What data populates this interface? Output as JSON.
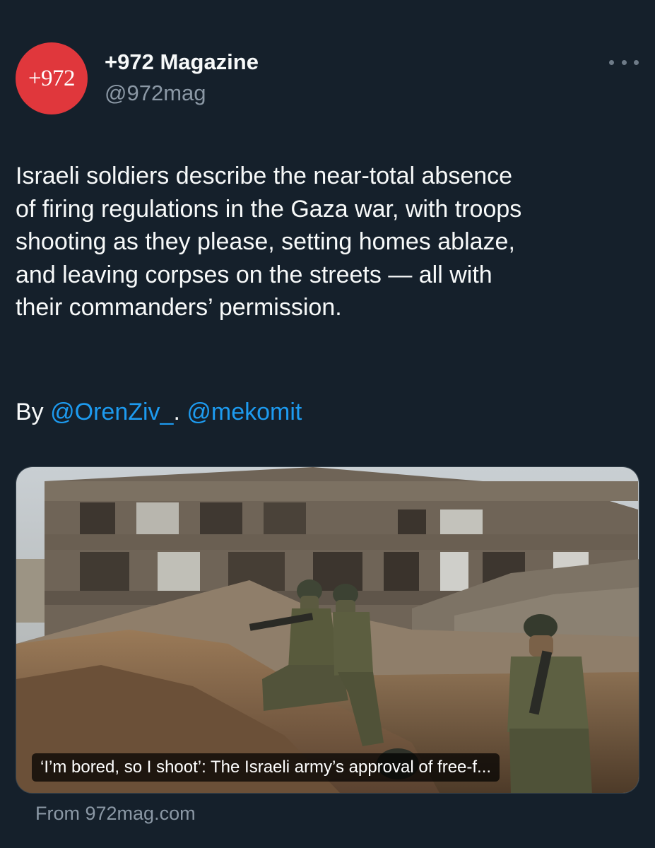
{
  "author": {
    "avatar_text": "+972",
    "display_name": "+972 Magazine",
    "handle": "@972mag"
  },
  "tweet": {
    "text": "Israeli soldiers describe the near-total absence\nof firing regulations in the Gaza war, with troops\nshooting as they please, setting homes ablaze,\nand leaving corpses on the streets — all with\ntheir commanders’ permission.",
    "byline_prefix": "By ",
    "mention_1": "@OrenZiv_",
    "separator": ". ",
    "mention_2": "@mekomit"
  },
  "link_card": {
    "title": "‘I’m bored, so I shoot’: The Israeli army’s approval of free-f...",
    "source": "From 972mag.com"
  },
  "icons": {
    "more": "more-horizontal-icon"
  },
  "colors": {
    "background": "#15202b",
    "text": "#f7f9f9",
    "secondary_text": "#8b98a5",
    "link": "#1d9bf0",
    "avatar": "#e0373c"
  }
}
